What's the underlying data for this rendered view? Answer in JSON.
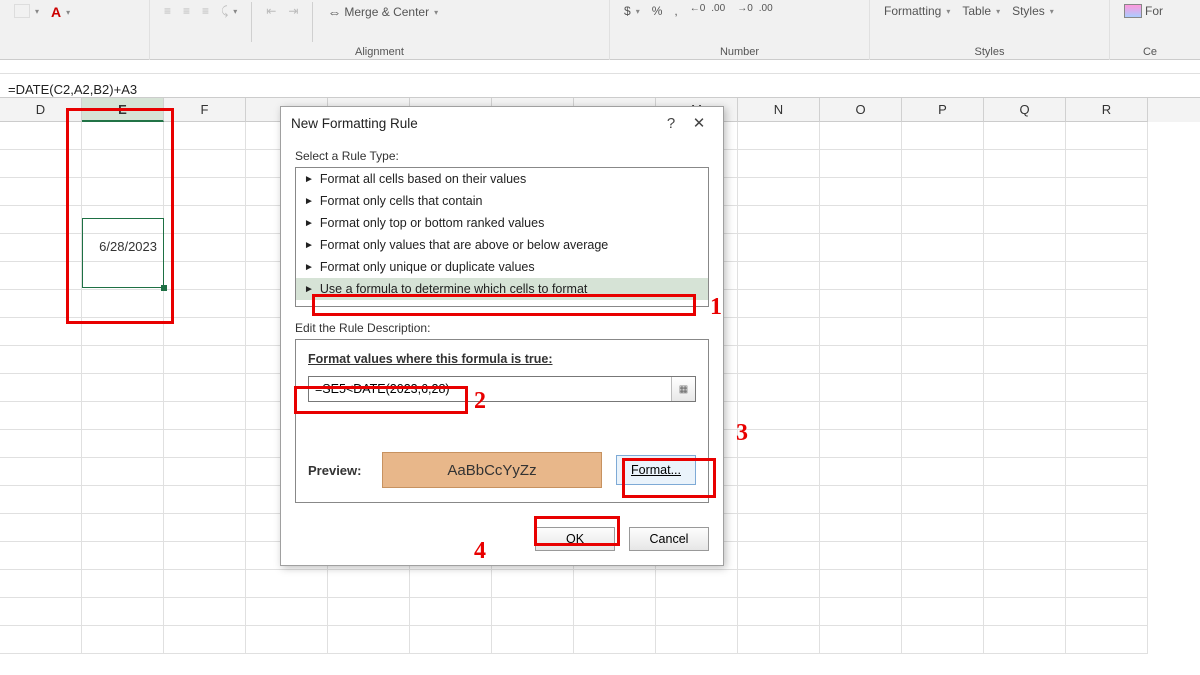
{
  "ribbon": {
    "merge_center": "Merge & Center",
    "font_a": "A",
    "dollar": "$",
    "percent": "%",
    "comma": ",",
    "inc_dec": ".00",
    "dec_dec": ".00",
    "formatting": "Formatting",
    "table": "Table",
    "styles": "Styles",
    "format_btn": "For",
    "group_alignment": "Alignment",
    "group_number": "Number",
    "group_styles": "Styles",
    "group_cells": "Ce"
  },
  "formula_bar": "=DATE(C2,A2,B2)+A3",
  "columns": [
    "D",
    "E",
    "F",
    "",
    "",
    "",
    "",
    "",
    "M",
    "N",
    "O",
    "P",
    "Q",
    "R"
  ],
  "selected_column": "E",
  "cell_value": "6/28/2023",
  "dialog": {
    "title": "New Formatting Rule",
    "select_label": "Select a Rule Type:",
    "rules": [
      "Format all cells based on their values",
      "Format only cells that contain",
      "Format only top or bottom ranked values",
      "Format only values that are above or below average",
      "Format only unique or duplicate values",
      "Use a formula to determine which cells to format"
    ],
    "edit_label": "Edit the Rule Description:",
    "formula_label": "Format values where this formula is true:",
    "formula_value": "=SE5<DATE(2023,6,28)",
    "preview_label": "Preview:",
    "preview_text": "AaBbCcYyZz",
    "format_btn": "Format...",
    "ok": "OK",
    "cancel": "Cancel"
  },
  "callouts": {
    "n1": "1",
    "n2": "2",
    "n3": "3",
    "n4": "4"
  }
}
